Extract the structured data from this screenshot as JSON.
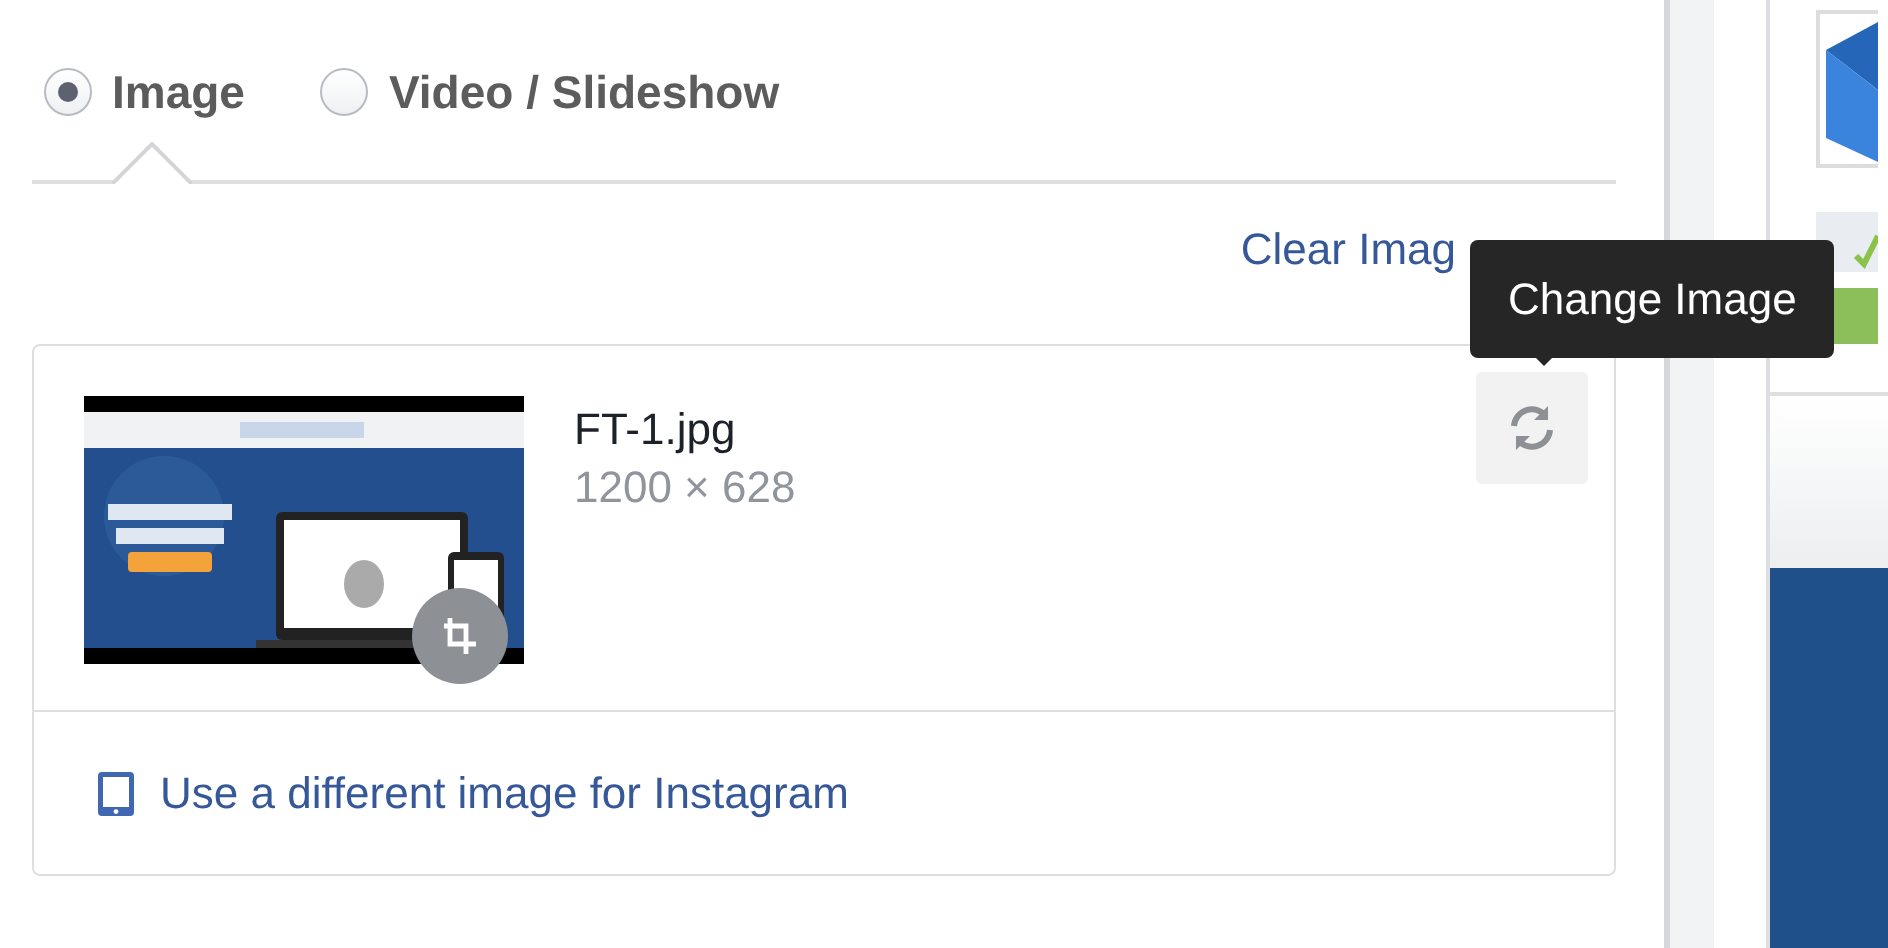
{
  "media_type": [
    {
      "label": "Image",
      "selected": true
    },
    {
      "label": "Video / Slideshow",
      "selected": false
    }
  ],
  "clear_link": "Clear Imag",
  "image": {
    "filename": "FT-1.jpg",
    "dimensions": "1200 × 628",
    "kind": "picture"
  },
  "tooltip": "Change Image",
  "instagram_link": "Use a different image for Instagram"
}
